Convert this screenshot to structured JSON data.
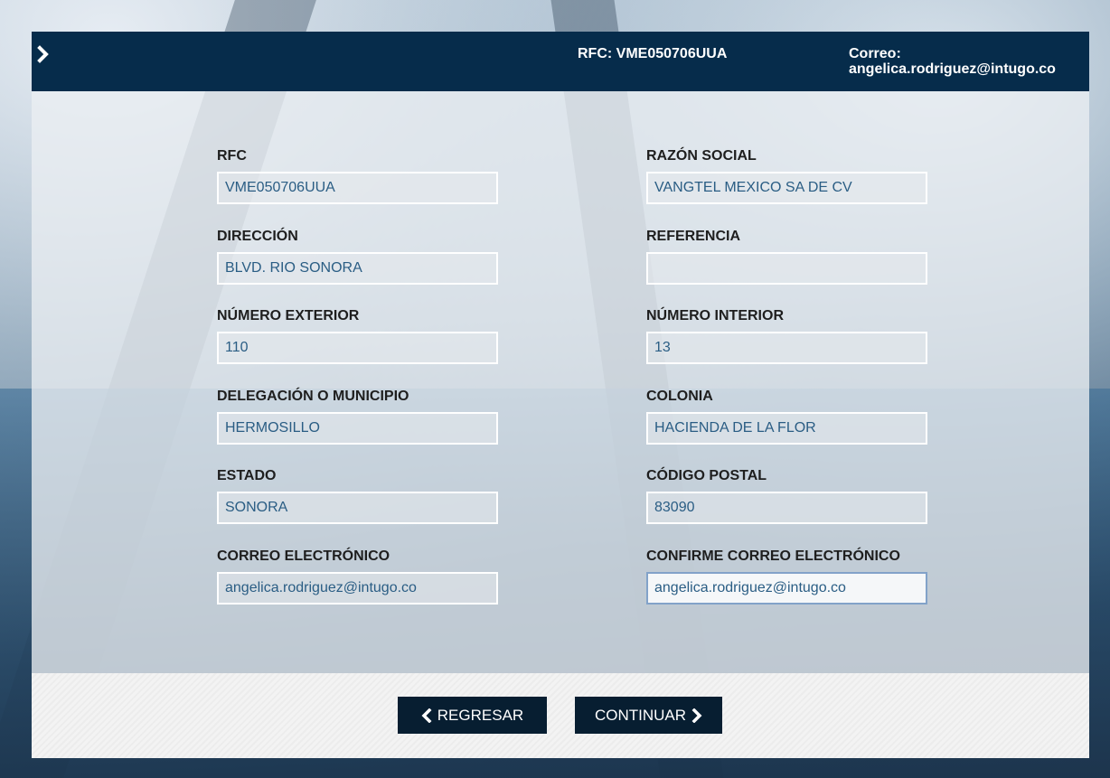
{
  "header": {
    "rfc": "RFC: VME050706UUA",
    "correo_label": "Correo:",
    "correo_value": "angelica.rodriguez@intugo.co"
  },
  "form": {
    "rfc": {
      "label": "RFC",
      "value": "VME050706UUA"
    },
    "razon_social": {
      "label": "RAZÓN SOCIAL",
      "value": "VANGTEL MEXICO SA DE CV"
    },
    "direccion": {
      "label": "DIRECCIÓN",
      "value": "BLVD. RIO SONORA"
    },
    "referencia": {
      "label": "REFERENCIA",
      "value": ""
    },
    "numero_exterior": {
      "label": "NÚMERO EXTERIOR",
      "value": "110"
    },
    "numero_interior": {
      "label": "NÚMERO INTERIOR",
      "value": "13"
    },
    "delegacion": {
      "label": "DELEGACIÓN O MUNICIPIO",
      "value": "HERMOSILLO"
    },
    "colonia": {
      "label": "COLONIA",
      "value": "HACIENDA DE LA FLOR"
    },
    "estado": {
      "label": "ESTADO",
      "value": "SONORA"
    },
    "codigo_postal": {
      "label": "CÓDIGO POSTAL",
      "value": "83090"
    },
    "correo": {
      "label": "CORREO ELECTRÓNICO",
      "value": "angelica.rodriguez@intugo.co"
    },
    "confirme_correo": {
      "label": "CONFIRME CORREO ELECTRÓNICO",
      "value": "angelica.rodriguez@intugo.co"
    }
  },
  "buttons": {
    "back": "REGRESAR",
    "next": "CONTINUAR"
  },
  "colors": {
    "header_bg": "#062c4b",
    "button_bg": "#071e31",
    "input_text": "#2a5d84",
    "focus_border": "#82a2c9"
  },
  "icons": {
    "menu_toggle": "chevron-right-icon",
    "back": "chevron-left-icon",
    "next": "chevron-right-icon"
  }
}
